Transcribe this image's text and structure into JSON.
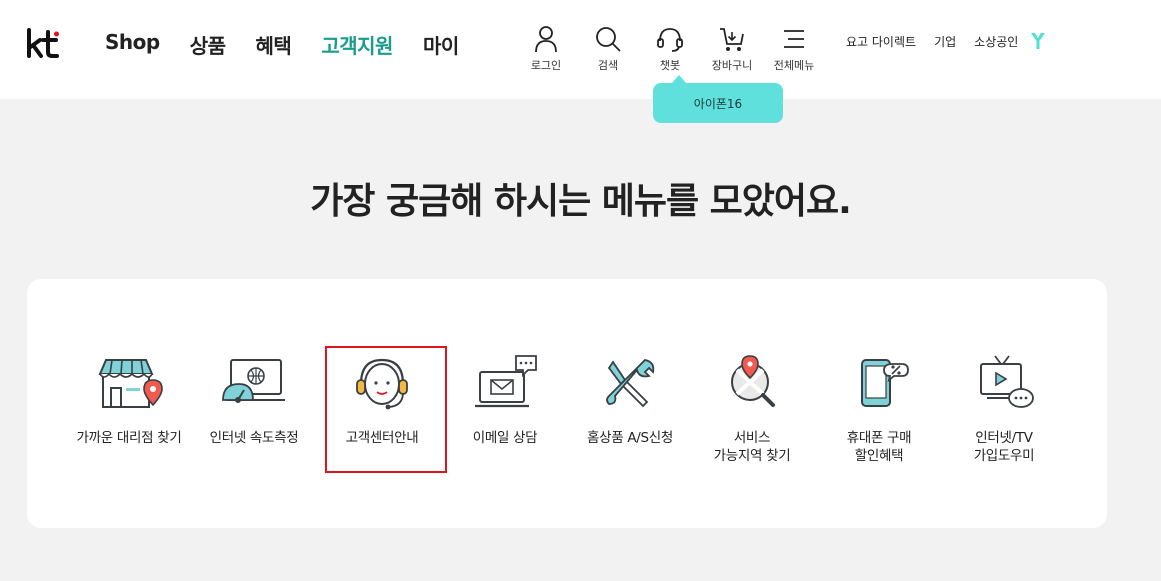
{
  "header": {
    "logo_text": "kt",
    "nav": [
      {
        "label": "Shop",
        "active": false
      },
      {
        "label": "상품",
        "active": false
      },
      {
        "label": "혜택",
        "active": false
      },
      {
        "label": "고객지원",
        "active": true
      },
      {
        "label": "마이",
        "active": false
      }
    ],
    "utils": [
      {
        "label": "로그인",
        "icon": "person-icon"
      },
      {
        "label": "검색",
        "icon": "search-icon"
      },
      {
        "label": "챗봇",
        "icon": "headset-icon"
      },
      {
        "label": "장바구니",
        "icon": "cart-icon"
      },
      {
        "label": "전체메뉴",
        "icon": "menu-icon"
      }
    ],
    "sub_links": [
      "요고 다이렉트",
      "기업",
      "소상공인"
    ],
    "tooltip": "아이폰16"
  },
  "main": {
    "headline": "가장 궁금해 하시는 메뉴를 모았어요.",
    "menus": [
      {
        "label": "가까운 대리점 찾기",
        "icon": "store-location-icon"
      },
      {
        "label": "인터넷 속도측정",
        "icon": "speed-monitor-icon"
      },
      {
        "label": "고객센터안내",
        "icon": "customer-center-headset-icon",
        "highlighted": true
      },
      {
        "label": "이메일 상담",
        "icon": "email-laptop-icon"
      },
      {
        "label": "홈상품 A/S신청",
        "icon": "tools-icon"
      },
      {
        "label": "서비스\n가능지역 찾기",
        "icon": "map-search-icon"
      },
      {
        "label": "휴대폰 구매\n할인혜택",
        "icon": "phone-discount-icon"
      },
      {
        "label": "인터넷/TV\n가입도우미",
        "icon": "tv-chat-icon"
      }
    ]
  },
  "colors": {
    "accent": "#1a9b8f",
    "kt_red": "#e0151b",
    "tooltip_bg": "#5fe0dc",
    "icon_teal": "#7fd3d8",
    "icon_dark": "#3a3f44"
  }
}
